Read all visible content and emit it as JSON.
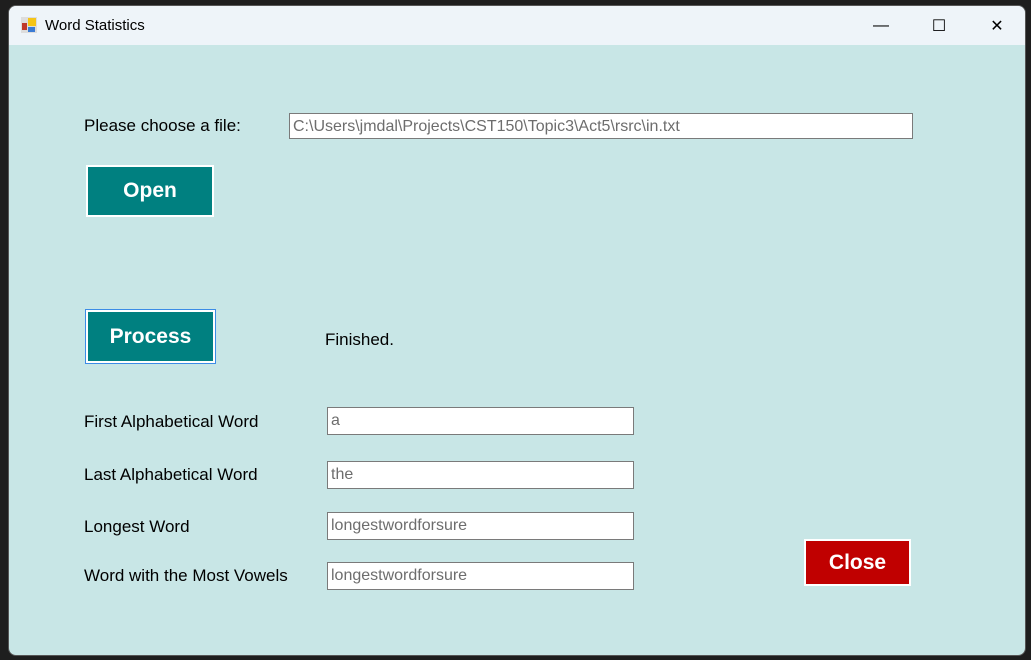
{
  "window": {
    "title": "Word Statistics",
    "minimize": "—",
    "maximize": "☐",
    "close": "✕"
  },
  "file": {
    "label": "Please choose a file:",
    "path": "C:\\Users\\jmdal\\Projects\\CST150\\Topic3\\Act5\\rsrc\\in.txt"
  },
  "buttons": {
    "open": "Open",
    "process": "Process",
    "close": "Close"
  },
  "status": "Finished.",
  "results": [
    {
      "label": "First Alphabetical Word",
      "value": "a"
    },
    {
      "label": "Last Alphabetical Word",
      "value": "the"
    },
    {
      "label": "Longest Word",
      "value": "longestwordforsure"
    },
    {
      "label": "Word with the Most Vowels",
      "value": "longestwordforsure"
    }
  ],
  "colors": {
    "background": "#c8e6e6",
    "teal": "#008080",
    "red": "#c00000"
  }
}
